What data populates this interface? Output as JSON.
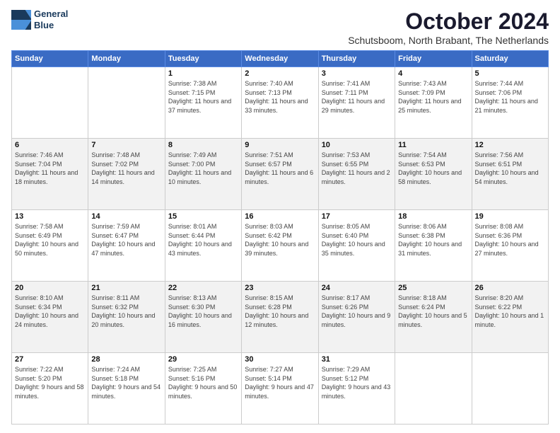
{
  "logo": {
    "line1": "General",
    "line2": "Blue"
  },
  "title": "October 2024",
  "subtitle": "Schutsboom, North Brabant, The Netherlands",
  "days_of_week": [
    "Sunday",
    "Monday",
    "Tuesday",
    "Wednesday",
    "Thursday",
    "Friday",
    "Saturday"
  ],
  "weeks": [
    [
      {
        "day": "",
        "info": ""
      },
      {
        "day": "",
        "info": ""
      },
      {
        "day": "1",
        "info": "Sunrise: 7:38 AM\nSunset: 7:15 PM\nDaylight: 11 hours and 37 minutes."
      },
      {
        "day": "2",
        "info": "Sunrise: 7:40 AM\nSunset: 7:13 PM\nDaylight: 11 hours and 33 minutes."
      },
      {
        "day": "3",
        "info": "Sunrise: 7:41 AM\nSunset: 7:11 PM\nDaylight: 11 hours and 29 minutes."
      },
      {
        "day": "4",
        "info": "Sunrise: 7:43 AM\nSunset: 7:09 PM\nDaylight: 11 hours and 25 minutes."
      },
      {
        "day": "5",
        "info": "Sunrise: 7:44 AM\nSunset: 7:06 PM\nDaylight: 11 hours and 21 minutes."
      }
    ],
    [
      {
        "day": "6",
        "info": "Sunrise: 7:46 AM\nSunset: 7:04 PM\nDaylight: 11 hours and 18 minutes."
      },
      {
        "day": "7",
        "info": "Sunrise: 7:48 AM\nSunset: 7:02 PM\nDaylight: 11 hours and 14 minutes."
      },
      {
        "day": "8",
        "info": "Sunrise: 7:49 AM\nSunset: 7:00 PM\nDaylight: 11 hours and 10 minutes."
      },
      {
        "day": "9",
        "info": "Sunrise: 7:51 AM\nSunset: 6:57 PM\nDaylight: 11 hours and 6 minutes."
      },
      {
        "day": "10",
        "info": "Sunrise: 7:53 AM\nSunset: 6:55 PM\nDaylight: 11 hours and 2 minutes."
      },
      {
        "day": "11",
        "info": "Sunrise: 7:54 AM\nSunset: 6:53 PM\nDaylight: 10 hours and 58 minutes."
      },
      {
        "day": "12",
        "info": "Sunrise: 7:56 AM\nSunset: 6:51 PM\nDaylight: 10 hours and 54 minutes."
      }
    ],
    [
      {
        "day": "13",
        "info": "Sunrise: 7:58 AM\nSunset: 6:49 PM\nDaylight: 10 hours and 50 minutes."
      },
      {
        "day": "14",
        "info": "Sunrise: 7:59 AM\nSunset: 6:47 PM\nDaylight: 10 hours and 47 minutes."
      },
      {
        "day": "15",
        "info": "Sunrise: 8:01 AM\nSunset: 6:44 PM\nDaylight: 10 hours and 43 minutes."
      },
      {
        "day": "16",
        "info": "Sunrise: 8:03 AM\nSunset: 6:42 PM\nDaylight: 10 hours and 39 minutes."
      },
      {
        "day": "17",
        "info": "Sunrise: 8:05 AM\nSunset: 6:40 PM\nDaylight: 10 hours and 35 minutes."
      },
      {
        "day": "18",
        "info": "Sunrise: 8:06 AM\nSunset: 6:38 PM\nDaylight: 10 hours and 31 minutes."
      },
      {
        "day": "19",
        "info": "Sunrise: 8:08 AM\nSunset: 6:36 PM\nDaylight: 10 hours and 27 minutes."
      }
    ],
    [
      {
        "day": "20",
        "info": "Sunrise: 8:10 AM\nSunset: 6:34 PM\nDaylight: 10 hours and 24 minutes."
      },
      {
        "day": "21",
        "info": "Sunrise: 8:11 AM\nSunset: 6:32 PM\nDaylight: 10 hours and 20 minutes."
      },
      {
        "day": "22",
        "info": "Sunrise: 8:13 AM\nSunset: 6:30 PM\nDaylight: 10 hours and 16 minutes."
      },
      {
        "day": "23",
        "info": "Sunrise: 8:15 AM\nSunset: 6:28 PM\nDaylight: 10 hours and 12 minutes."
      },
      {
        "day": "24",
        "info": "Sunrise: 8:17 AM\nSunset: 6:26 PM\nDaylight: 10 hours and 9 minutes."
      },
      {
        "day": "25",
        "info": "Sunrise: 8:18 AM\nSunset: 6:24 PM\nDaylight: 10 hours and 5 minutes."
      },
      {
        "day": "26",
        "info": "Sunrise: 8:20 AM\nSunset: 6:22 PM\nDaylight: 10 hours and 1 minute."
      }
    ],
    [
      {
        "day": "27",
        "info": "Sunrise: 7:22 AM\nSunset: 5:20 PM\nDaylight: 9 hours and 58 minutes."
      },
      {
        "day": "28",
        "info": "Sunrise: 7:24 AM\nSunset: 5:18 PM\nDaylight: 9 hours and 54 minutes."
      },
      {
        "day": "29",
        "info": "Sunrise: 7:25 AM\nSunset: 5:16 PM\nDaylight: 9 hours and 50 minutes."
      },
      {
        "day": "30",
        "info": "Sunrise: 7:27 AM\nSunset: 5:14 PM\nDaylight: 9 hours and 47 minutes."
      },
      {
        "day": "31",
        "info": "Sunrise: 7:29 AM\nSunset: 5:12 PM\nDaylight: 9 hours and 43 minutes."
      },
      {
        "day": "",
        "info": ""
      },
      {
        "day": "",
        "info": ""
      }
    ]
  ]
}
